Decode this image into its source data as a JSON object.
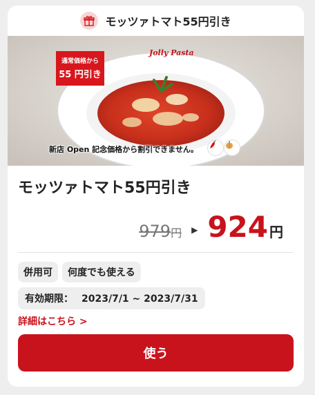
{
  "header": {
    "title": "モッツァトマト55円引き",
    "icon": "gift-icon"
  },
  "hero": {
    "logo_text": "Jolly Pasta",
    "badge_line1": "通常価格から",
    "badge_line2": "55 円引き",
    "note": "新店 Open 記念価格から割引できません。",
    "icons": [
      "chili-icon",
      "garlic-icon"
    ]
  },
  "coupon": {
    "title": "モッツァトマト55円引き",
    "old_price": "979",
    "old_unit": "円",
    "new_price": "924",
    "new_unit": "円"
  },
  "chips": [
    "併用可",
    "何度でも使える"
  ],
  "validity": {
    "label": "有効期限：",
    "range": "2023/7/1 ~ 2023/7/31"
  },
  "details_link": "詳細はこちら >",
  "use_button": "使う",
  "colors": {
    "accent": "#c8131c",
    "badge": "#d8161d"
  }
}
